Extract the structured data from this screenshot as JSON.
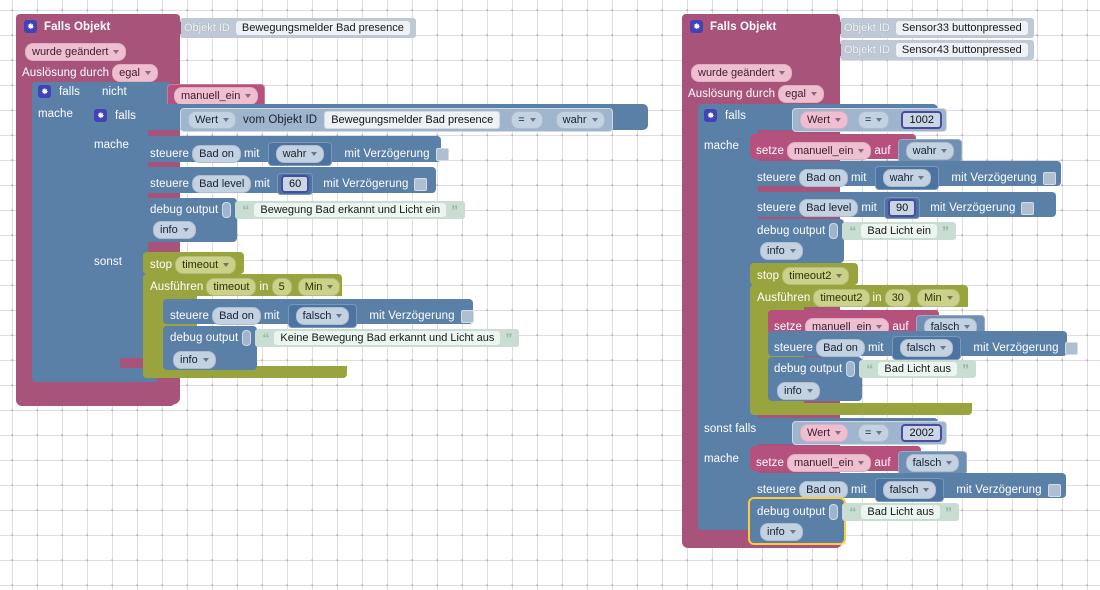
{
  "app": {
    "name": "ioBroker Blockly Script Editor",
    "canvas_bg": "#ffffff"
  },
  "palette": {
    "event_block": "#a8547a",
    "control_block": "#5b80a8",
    "timer_block": "#9aa43f",
    "string_block": "#c9ddd2",
    "variable_chip": "#efbfd1",
    "number_border": "#4a4aa0",
    "selection_outline": "#ffc83d",
    "objekt_id_block": "#bfc9d6"
  },
  "scripts": [
    {
      "id": "script-left",
      "trigger": {
        "icon": "gear-icon",
        "title": "Falls Objekt",
        "objekt_ids": [
          {
            "key": "Objekt ID",
            "value": "Bewegungsmelder Bad presence"
          }
        ],
        "condition": "wurde geändert",
        "source_label": "Auslösung durch",
        "source_value": "egal"
      },
      "if_outer": {
        "icon": "gear-icon",
        "keyword": "falls",
        "not": "nicht",
        "variable": "manuell_ein",
        "do_label": "mache"
      },
      "if_inner": {
        "icon": "gear-icon",
        "keyword": "falls",
        "value_field": "Wert",
        "from_label": "vom Objekt ID",
        "object_id": "Bewegungsmelder Bad presence",
        "operator": "=",
        "compare": "wahr",
        "do_label": "mache",
        "else_label": "sonst"
      },
      "then_statements": [
        {
          "type": "control",
          "verb": "steuere",
          "target": "Bad on",
          "with": "mit",
          "value": "wahr",
          "value_kind": "dropdown",
          "delay_label": "mit Verzögerung"
        },
        {
          "type": "control",
          "verb": "steuere",
          "target": "Bad level",
          "with": "mit",
          "value": "60",
          "value_kind": "number",
          "delay_label": "mit Verzögerung"
        },
        {
          "type": "debug",
          "label": "debug output",
          "text": "Bewegung Bad erkannt und Licht ein",
          "level": "info"
        }
      ],
      "else_statements": [
        {
          "type": "timer_stop",
          "label": "stop",
          "name": "timeout"
        },
        {
          "type": "timer_run",
          "label": "Ausführen",
          "name": "timeout",
          "in_label": "in",
          "amount": "5",
          "unit": "Min",
          "body": [
            {
              "type": "control",
              "verb": "steuere",
              "target": "Bad on",
              "with": "mit",
              "value": "falsch",
              "value_kind": "dropdown",
              "delay_label": "mit Verzögerung"
            },
            {
              "type": "debug",
              "label": "debug output",
              "text": "Keine Bewegung Bad erkannt und Licht aus",
              "level": "info"
            }
          ]
        }
      ]
    },
    {
      "id": "script-right",
      "trigger": {
        "icon": "gear-icon",
        "title": "Falls Objekt",
        "objekt_ids": [
          {
            "key": "Objekt ID",
            "value": "Sensor33 buttonpressed"
          },
          {
            "key": "Objekt ID",
            "value": "Sensor43 buttonpressed"
          }
        ],
        "condition": "wurde geändert",
        "source_label": "Auslösung durch",
        "source_value": "egal"
      },
      "if_block": {
        "icon": "gear-icon",
        "keyword": "falls",
        "value_field": "Wert",
        "operator": "=",
        "compare": "1002",
        "do_label": "mache",
        "elseif_label": "sonst falls",
        "elseif_value_field": "Wert",
        "elseif_operator": "=",
        "elseif_compare": "2002",
        "elseif_do_label": "mache"
      },
      "then_statements": [
        {
          "type": "set",
          "verb": "setze",
          "variable": "manuell_ein",
          "to": "auf",
          "value": "wahr"
        },
        {
          "type": "control",
          "verb": "steuere",
          "target": "Bad on",
          "with": "mit",
          "value": "wahr",
          "value_kind": "dropdown",
          "delay_label": "mit Verzögerung"
        },
        {
          "type": "control",
          "verb": "steuere",
          "target": "Bad level",
          "with": "mit",
          "value": "90",
          "value_kind": "number",
          "delay_label": "mit Verzögerung"
        },
        {
          "type": "debug",
          "label": "debug output",
          "text": "Bad Licht ein",
          "level": "info"
        },
        {
          "type": "timer_stop",
          "label": "stop",
          "name": "timeout2"
        },
        {
          "type": "timer_run",
          "label": "Ausführen",
          "name": "timeout2",
          "in_label": "in",
          "amount": "30",
          "unit": "Min",
          "body": [
            {
              "type": "set",
              "verb": "setze",
              "variable": "manuell_ein",
              "to": "auf",
              "value": "falsch"
            },
            {
              "type": "control",
              "verb": "steuere",
              "target": "Bad on",
              "with": "mit",
              "value": "falsch",
              "value_kind": "dropdown",
              "delay_label": "mit Verzögerung"
            },
            {
              "type": "debug",
              "label": "debug output",
              "text": "Bad Licht aus",
              "level": "info"
            }
          ]
        }
      ],
      "elseif_statements": [
        {
          "type": "set",
          "verb": "setze",
          "variable": "manuell_ein",
          "to": "auf",
          "value": "falsch"
        },
        {
          "type": "control",
          "verb": "steuere",
          "target": "Bad on",
          "with": "mit",
          "value": "falsch",
          "value_kind": "dropdown",
          "delay_label": "mit Verzögerung"
        },
        {
          "type": "debug",
          "label": "debug output",
          "text": "Bad Licht aus",
          "level": "info",
          "selected": true
        }
      ]
    }
  ]
}
